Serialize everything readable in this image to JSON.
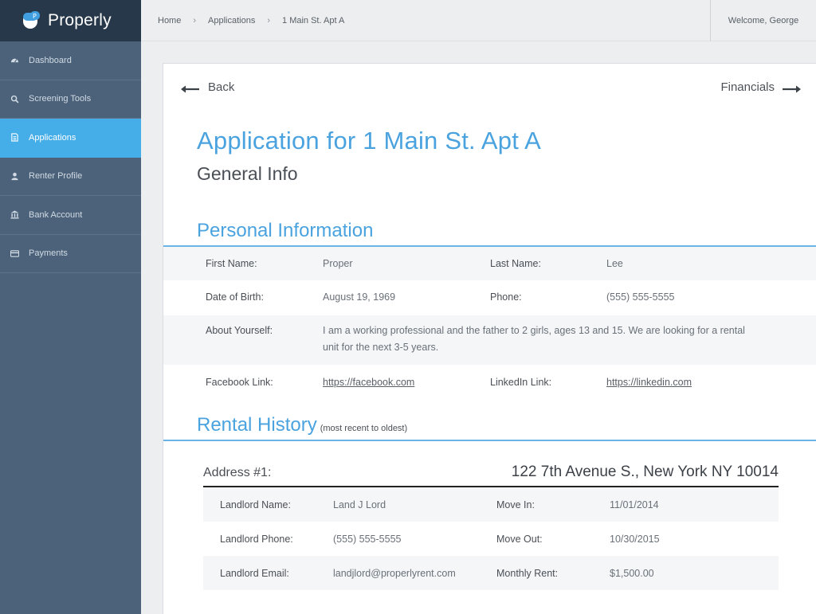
{
  "app": {
    "name": "Properly"
  },
  "sidebar": {
    "items": [
      {
        "label": "Dashboard",
        "icon": "dashboard-icon"
      },
      {
        "label": "Screening Tools",
        "icon": "search-icon"
      },
      {
        "label": "Applications",
        "icon": "document-icon",
        "active": true
      },
      {
        "label": "Renter Profile",
        "icon": "user-icon"
      },
      {
        "label": "Bank Account",
        "icon": "bank-icon"
      },
      {
        "label": "Payments",
        "icon": "credit-card-icon"
      }
    ]
  },
  "topbar": {
    "breadcrumbs": [
      "Home",
      "Applications",
      "1 Main St. Apt A"
    ],
    "separator": "›",
    "welcome": "Welcome, George"
  },
  "pager": {
    "back_label": "Back",
    "next_label": "Financials"
  },
  "page": {
    "title": "Application for 1 Main St. Apt A",
    "subtitle": "General Info"
  },
  "personal": {
    "heading": "Personal Information",
    "rows": {
      "first_name_label": "First Name:",
      "first_name": "Proper",
      "last_name_label": "Last Name:",
      "last_name": "Lee",
      "dob_label": "Date of Birth:",
      "dob": "August 19, 1969",
      "phone_label": "Phone:",
      "phone": "(555) 555-5555",
      "about_label": "About Yourself:",
      "about": "I am a working professional and the father to 2 girls, ages 13 and 15. We are looking for a rental unit for the next 3-5 years.",
      "facebook_label": "Facebook Link:",
      "facebook": "https://facebook.com",
      "linkedin_label": "LinkedIn Link:",
      "linkedin": "https://linkedin.com"
    }
  },
  "rental": {
    "heading": "Rental History",
    "note": "(most recent to oldest)",
    "address_label": "Address #1:",
    "address": "122 7th Avenue S., New York NY 10014",
    "rows": {
      "landlord_name_label": "Landlord Name:",
      "landlord_name": "Land J Lord",
      "move_in_label": "Move In:",
      "move_in": "11/01/2014",
      "landlord_phone_label": "Landlord Phone:",
      "landlord_phone": "(555) 555-5555",
      "move_out_label": "Move Out:",
      "move_out": "10/30/2015",
      "landlord_email_label": "Landlord Email:",
      "landlord_email": "landjlord@properlyrent.com",
      "rent_label": "Monthly Rent:",
      "rent": "$1,500.00"
    }
  },
  "colors": {
    "accent": "#4aa3df",
    "sidebar_bg": "#4b627a",
    "sidebar_active": "#45aee8",
    "brand_bg": "#27384a"
  }
}
